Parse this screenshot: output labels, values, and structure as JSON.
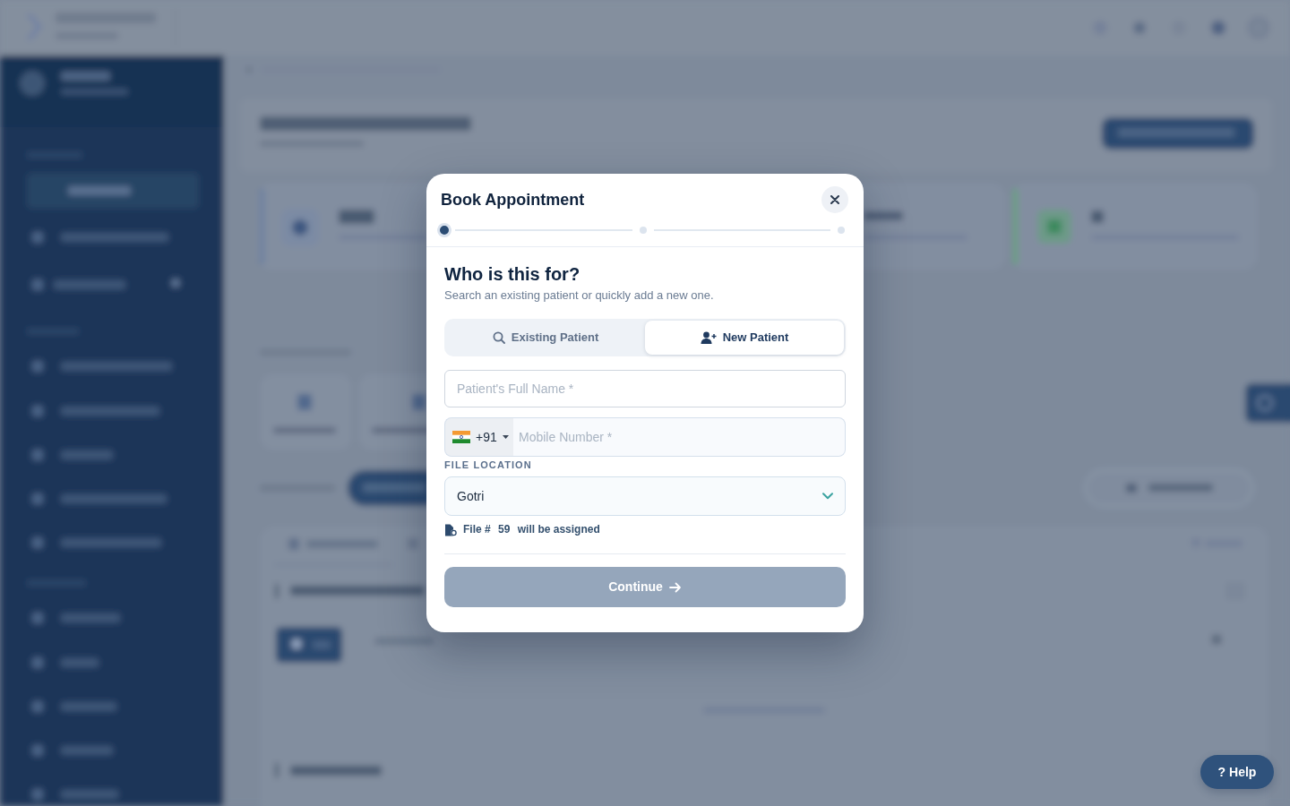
{
  "dialog": {
    "title": "Book Appointment",
    "steps": [
      {
        "selected": true
      },
      {
        "selected": false
      },
      {
        "selected": false
      }
    ],
    "heading": "Who is this for?",
    "subtitle": "Search an existing patient or quickly add a new one.",
    "patient_tabs": [
      {
        "label": "Existing Patient",
        "selected": false
      },
      {
        "label": "New Patient",
        "selected": true
      }
    ],
    "full_name": {
      "placeholder": "Patient's Full Name *"
    },
    "mobile": {
      "country_code": "+91",
      "placeholder": "Mobile Number *"
    },
    "file_location": {
      "label": "FILE LOCATION",
      "value": "Gotri"
    },
    "file_note": {
      "prefix": "File #",
      "number": "59",
      "suffix": "will be assigned"
    },
    "continue_button": {
      "label": "Continue",
      "disabled": true
    }
  },
  "help_button": {
    "label": "? Help"
  }
}
